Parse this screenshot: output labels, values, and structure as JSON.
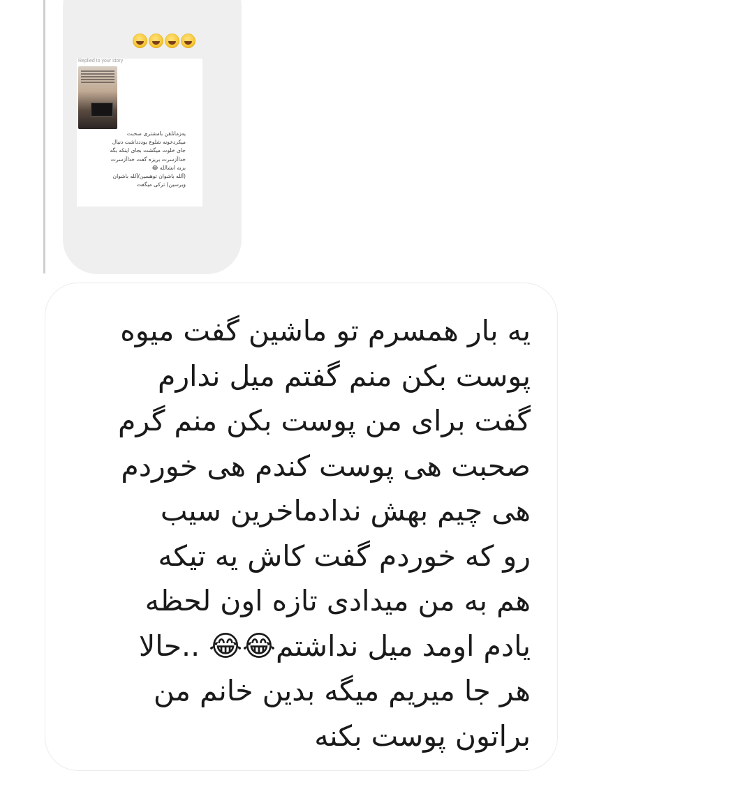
{
  "story_reply": {
    "reaction_emoji": [
      "😂",
      "😂",
      "😂",
      "😂"
    ],
    "replied_label": "Replied to your story",
    "story_text": "یه‌زمانلقن بامشتری صحبت\nمیکردخونه شلوغ بوددداشت دنبال\nجای خلوت میگشت بجای اینکه بگه\nخدااَزسرت بریزه گفت خدااَزسرت\nبزنه انشالله 😂\n(اَلله باشوان توهسین/اَلله باشوان\nویرسین) ترکی میگفت"
  },
  "message": {
    "text": "یه بار همسرم تو ماشین گفت میوه\nپوست بکن منم گفتم میل ندارم\nگفت برای من پوست بکن منم گرم\nصحبت هی پوست کندم هی خوردم\nهی چیم بهش ندادماخرین سیب\nرو که خوردم گفت کاش یه تیکه\nهم به من میدادی تازه اون لحظه\nیادم اومد میل نداشتم😂😂 ..حالا\nهر جا میریم میگه بدین خانم من\nبراتون پوست بکنه"
  },
  "colors": {
    "background": "#ffffff",
    "reply_bubble": "#efefef",
    "message_border": "#ececec",
    "text": "#1a1a1a"
  }
}
